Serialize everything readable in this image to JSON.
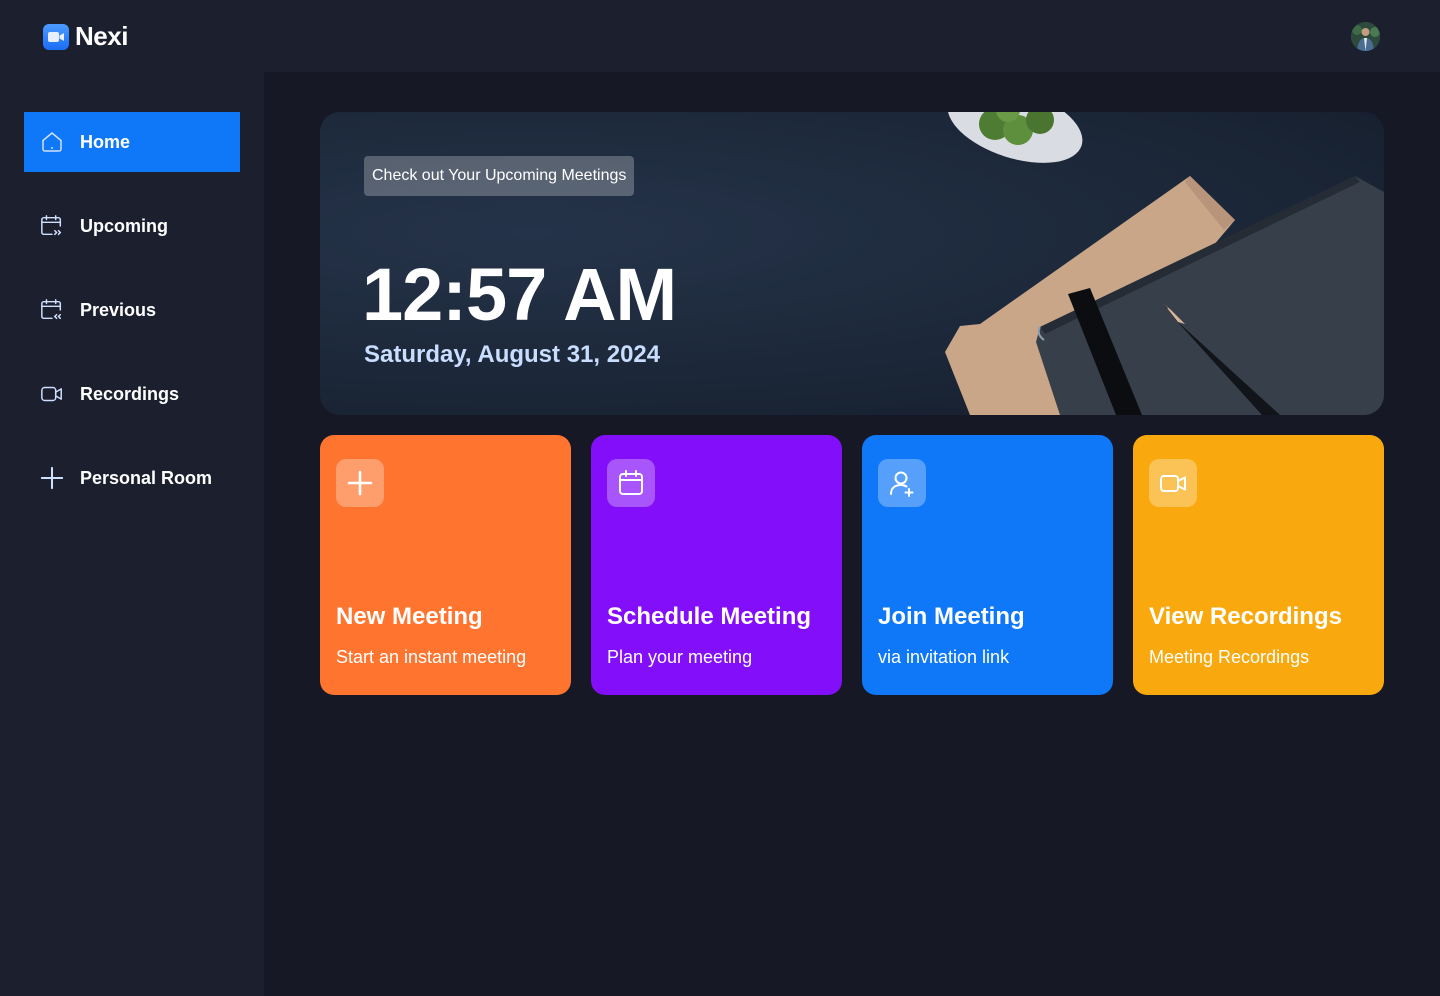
{
  "app": {
    "name": "Nexi"
  },
  "header": {
    "avatar_alt": "User avatar"
  },
  "sidebar": {
    "items": [
      {
        "label": "Home",
        "icon": "home-icon",
        "active": true
      },
      {
        "label": "Upcoming",
        "icon": "calendar-forward-icon",
        "active": false
      },
      {
        "label": "Previous",
        "icon": "calendar-back-icon",
        "active": false
      },
      {
        "label": "Recordings",
        "icon": "video-icon",
        "active": false
      },
      {
        "label": "Personal Room",
        "icon": "plus-icon",
        "active": false
      }
    ]
  },
  "hero": {
    "badge": "Check out Your Upcoming Meetings",
    "time": "12:57 AM",
    "date": "Saturday, August 31, 2024"
  },
  "cards": [
    {
      "title": "New Meeting",
      "subtitle": "Start an instant meeting",
      "icon": "plus-icon",
      "color": "#ff742e"
    },
    {
      "title": "Schedule Meeting",
      "subtitle": "Plan your meeting",
      "icon": "calendar-icon",
      "color": "#830ef9"
    },
    {
      "title": "Join Meeting",
      "subtitle": "via invitation link",
      "icon": "add-user-icon",
      "color": "#0e78f9"
    },
    {
      "title": "View Recordings",
      "subtitle": "Meeting Recordings",
      "icon": "video-icon",
      "color": "#f9a90e"
    }
  ],
  "colors": {
    "accent": "#0e78f9",
    "sidebar_bg": "#1c1f2e",
    "main_bg": "#161925"
  }
}
